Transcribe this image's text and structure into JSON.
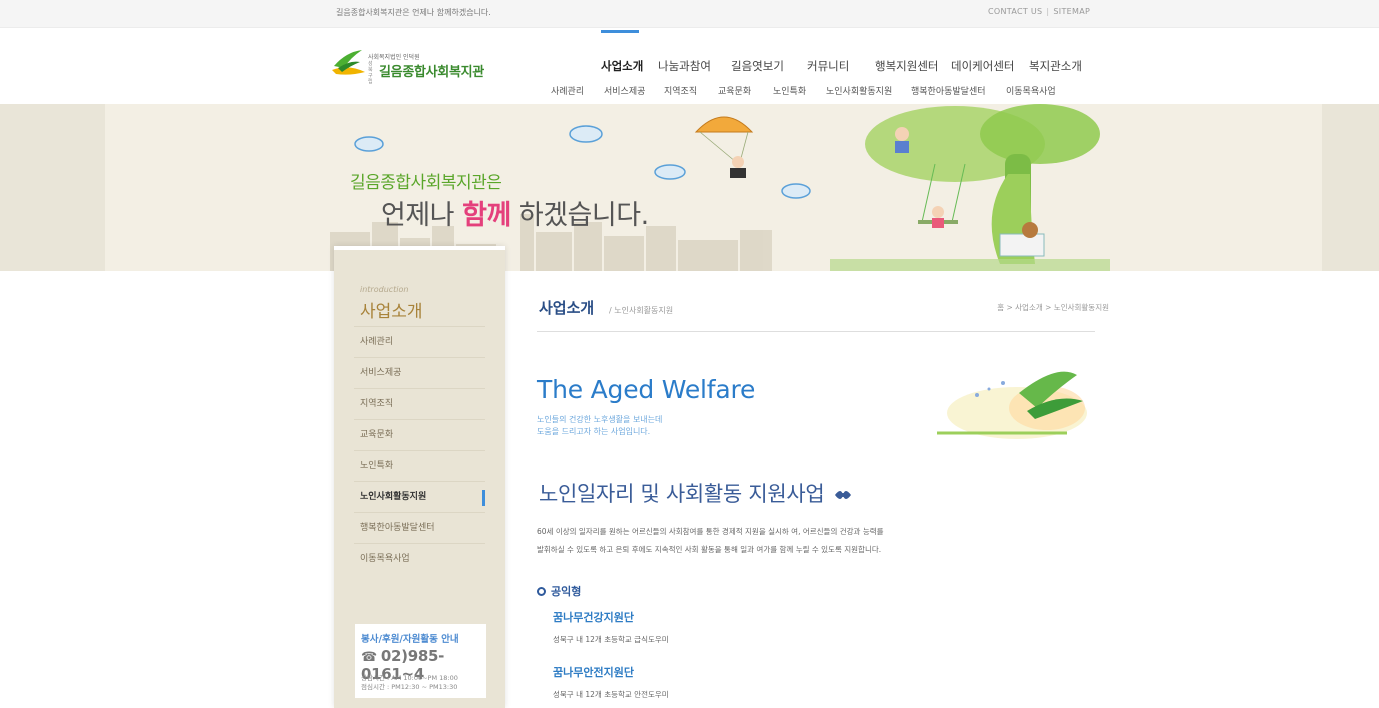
{
  "topbar": {
    "slogan": "길음종합사회복지관은 언제나 함께하겠습니다.",
    "contact_us": "CONTACT US",
    "separator": "|",
    "sitemap": "SITEMAP"
  },
  "logo": {
    "line1": "사회복지법인 인덕원",
    "line2": "성북 구립",
    "name": "길음종합사회복지관"
  },
  "gnb": {
    "items": [
      "사업소개",
      "나눔과참여",
      "길음엿보기",
      "커뮤니티",
      "행복지원센터",
      "데이케어센터",
      "복지관소개"
    ],
    "sub": [
      "사례관리",
      "서비스제공",
      "지역조직",
      "교육문화",
      "노인특화",
      "노인사회활동지원",
      "행복한아동발달센터",
      "이동목욕사업"
    ]
  },
  "banner": {
    "line1": "길음종합사회복지관은",
    "line2_a": "언제나 ",
    "line2_hl": "함께",
    "line2_b": " 하겠습니다."
  },
  "lnb": {
    "intro": "introduction",
    "title": "사업소개",
    "menu": [
      "사례관리",
      "서비스제공",
      "지역조직",
      "교육문화",
      "노인특화",
      "노인사회활동지원",
      "행복한아동발달센터",
      "이동목욕사업"
    ],
    "active_index": 5,
    "contact": {
      "title": "봉사/후원/자원활동 안내",
      "phone": "02)985-0161~4",
      "hours1": "상담시간 : AM 10:00~PM 18:00",
      "hours2": "점심시간 : PM12:30 ~ PM13:30"
    }
  },
  "content": {
    "title": "사업소개",
    "subtitle": "/ 노인사회활동지원",
    "breadcrumb": "홈 > 사업소개 > 노인사회활동지원",
    "aged_title": "The Aged Welfare",
    "aged_desc1": "노인들의 건강한 노후생활을 보내는데",
    "aged_desc2": "도움을 드리고자 하는 사업입니다.",
    "heading": "노인일자리 및 사회활동 지원사업",
    "para1": "60세 이상의 일자리를 원하는 어르신들의 사회참여를 통한 경제적 지원을 실시하 여, 어르신들의 건강과 능력를",
    "para2": "발휘하실 수 있도록 하고 은퇴 후에도 지속적인 사회 활동을 통해 일과 여가를 함께 누릴 수 있도록 지원합니다.",
    "section": "공익형",
    "program1_title": "꿈나무건강지원단",
    "program1_desc": "성북구 내 12개 초등학교 급식도우미",
    "program2_title": "꿈나무안전지원단",
    "program2_desc": "성북구 내 12개 초등학교 안전도우미"
  },
  "colors": {
    "accent": "#3e8edb",
    "brand_green": "#3a8a2e",
    "highlight_pink": "#e4407c",
    "lnb_bg": "#e9e4d5"
  }
}
